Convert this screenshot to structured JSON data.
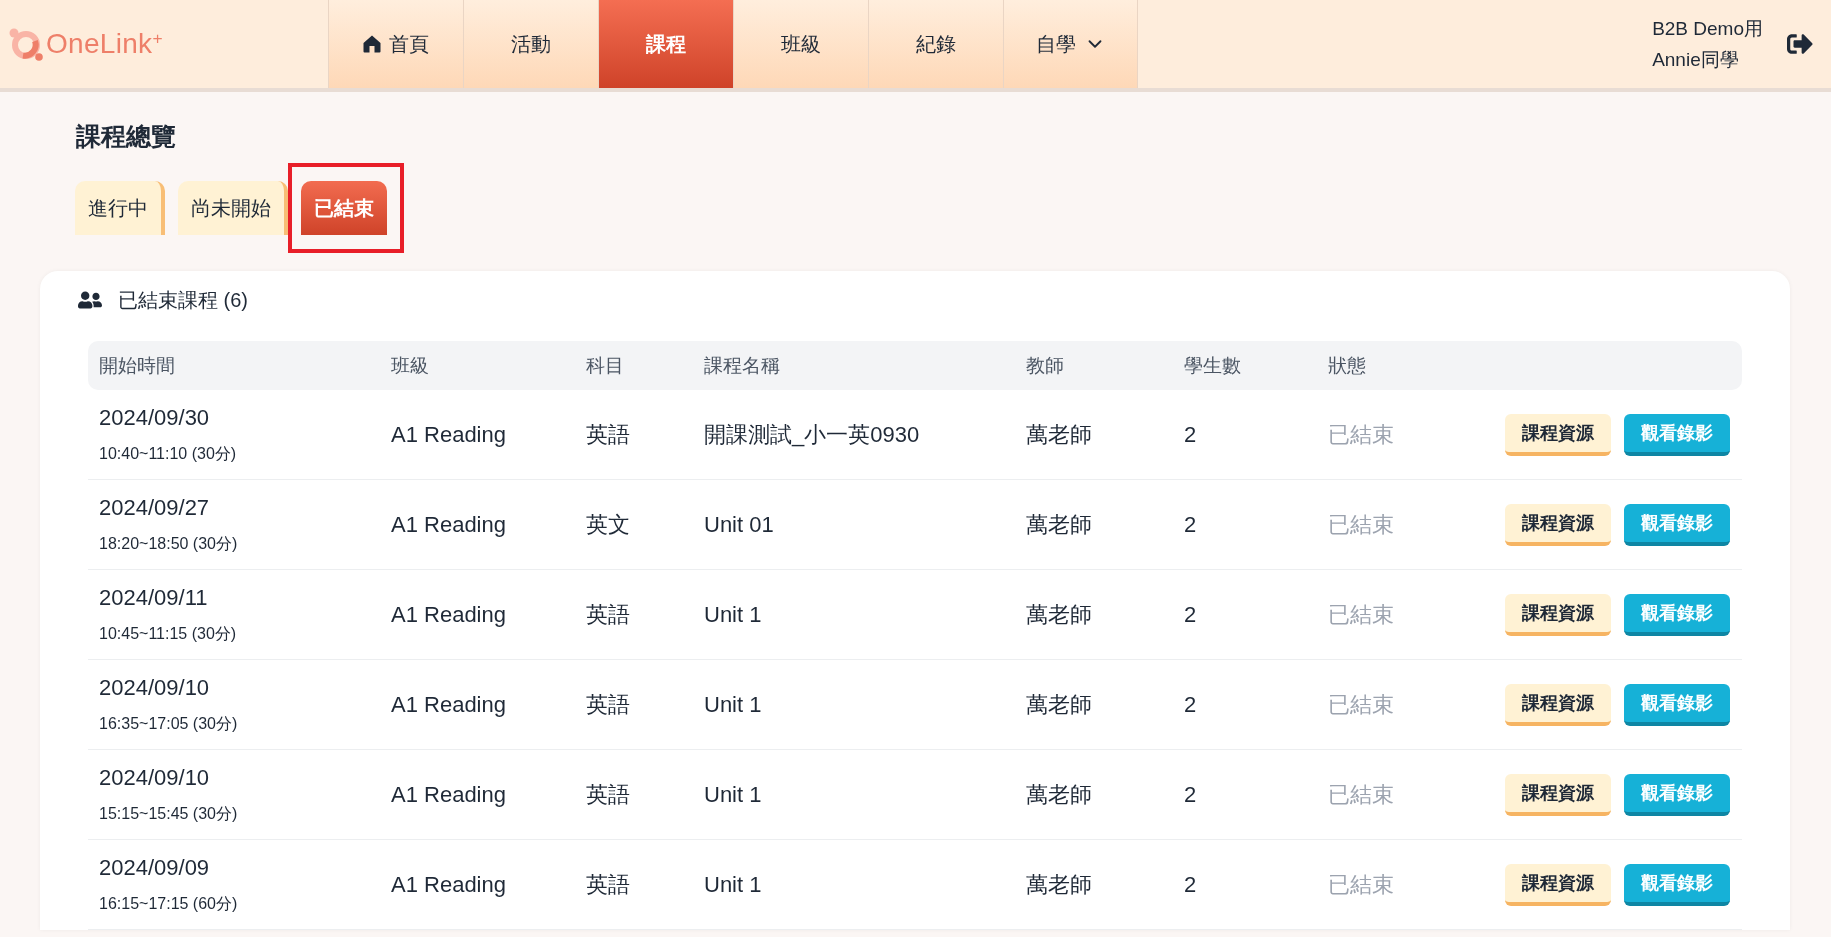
{
  "header": {
    "logo": "OneLink$^{+}$",
    "nav": [
      {
        "label": "首頁",
        "kind": "home",
        "selected": false
      },
      {
        "label": "活動",
        "kind": "plain",
        "selected": false
      },
      {
        "label": "課程",
        "kind": "plain",
        "selected": true
      },
      {
        "label": "班級",
        "kind": "plain",
        "selected": false
      },
      {
        "label": "紀錄",
        "kind": "plain",
        "selected": false
      },
      {
        "label": "自學",
        "kind": "dropdown",
        "selected": false
      }
    ],
    "user": {
      "org": "B2B Demo用",
      "name": "Annie同學"
    }
  },
  "page": {
    "title": "課程總覽",
    "tabs": [
      {
        "label": "進行中",
        "selected": false,
        "highlighted": false
      },
      {
        "label": "尚未開始",
        "selected": false,
        "highlighted": false
      },
      {
        "label": "已結束",
        "selected": true,
        "highlighted": true
      }
    ]
  },
  "card": {
    "title": "已結束課程 (6)",
    "table": {
      "columns": [
        "開始時間",
        "班級",
        "科目",
        "課程名稱",
        "教師",
        "學生數",
        "狀態"
      ],
      "rows": [
        {
          "date": "2024/09/30",
          "time": "10:40~11:10 (30分)",
          "class": "A1 Reading",
          "subject": "英語",
          "course": "開課測試_小一英0930",
          "teacher": "萬老師",
          "students": "2",
          "status": "已結束",
          "actions": [
            {
              "label": "課程資源",
              "kind": "light"
            },
            {
              "label": "觀看錄影",
              "kind": "accent"
            }
          ]
        },
        {
          "date": "2024/09/27",
          "time": "18:20~18:50 (30分)",
          "class": "A1 Reading",
          "subject": "英文",
          "course": "Unit 01",
          "teacher": "萬老師",
          "students": "2",
          "status": "已結束",
          "actions": [
            {
              "label": "課程資源",
              "kind": "light"
            },
            {
              "label": "觀看錄影",
              "kind": "accent"
            }
          ]
        },
        {
          "date": "2024/09/11",
          "time": "10:45~11:15 (30分)",
          "class": "A1 Reading",
          "subject": "英語",
          "course": "Unit 1",
          "teacher": "萬老師",
          "students": "2",
          "status": "已結束",
          "actions": [
            {
              "label": "課程資源",
              "kind": "light"
            },
            {
              "label": "觀看錄影",
              "kind": "accent"
            }
          ]
        },
        {
          "date": "2024/09/10",
          "time": "16:35~17:05 (30分)",
          "class": "A1 Reading",
          "subject": "英語",
          "course": "Unit 1",
          "teacher": "萬老師",
          "students": "2",
          "status": "已結束",
          "actions": [
            {
              "label": "課程資源",
              "kind": "light"
            },
            {
              "label": "觀看錄影",
              "kind": "accent"
            }
          ]
        },
        {
          "date": "2024/09/10",
          "time": "15:15~15:45 (30分)",
          "class": "A1 Reading",
          "subject": "英語",
          "course": "Unit 1",
          "teacher": "萬老師",
          "students": "2",
          "status": "已結束",
          "actions": [
            {
              "label": "課程資源",
              "kind": "light"
            },
            {
              "label": "觀看錄影",
              "kind": "accent"
            }
          ]
        },
        {
          "date": "2024/09/09",
          "time": "16:15~17:15 (60分)",
          "class": "A1 Reading",
          "subject": "英語",
          "course": "Unit 1",
          "teacher": "萬老師",
          "students": "2",
          "status": "已結束",
          "actions": [
            {
              "label": "課程資源",
              "kind": "light"
            },
            {
              "label": "觀看錄影",
              "kind": "accent"
            }
          ]
        }
      ]
    }
  }
}
